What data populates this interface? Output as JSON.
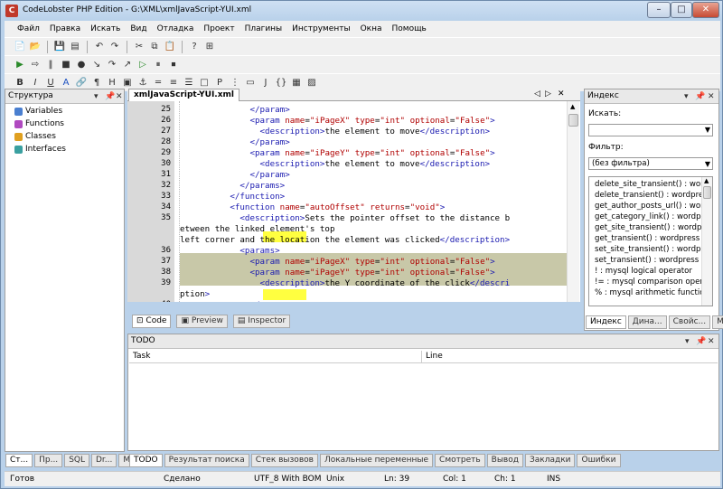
{
  "window": {
    "title": "CodeLobster PHP Edition - G:\\XML\\xmlJavaScript-YUI.xml",
    "minimize": "–",
    "maximize": "□",
    "close": "✕"
  },
  "menu": [
    "Файл",
    "Правка",
    "Искать",
    "Вид",
    "Отладка",
    "Проект",
    "Плагины",
    "Инструменты",
    "Окна",
    "Помощь"
  ],
  "structure": {
    "title": "Структура",
    "items": [
      "Variables",
      "Functions",
      "Classes",
      "Interfaces"
    ]
  },
  "editor": {
    "tab": "xmlJavaScript-YUI.xml",
    "line_numbers": [
      "25",
      "26",
      "27",
      "28",
      "29",
      "30",
      "31",
      "32",
      "33",
      "34",
      "35",
      "",
      "",
      "36",
      "37",
      "38",
      "39",
      "",
      "40"
    ],
    "lines": [
      {
        "indent": "              ",
        "html": "</param>"
      },
      {
        "indent": "              ",
        "html": "<param name=\"iPageX\" type=\"int\" optional=\"False\">"
      },
      {
        "indent": "                ",
        "html": "<description>the element to move</description>"
      },
      {
        "indent": "              ",
        "html": "</param>"
      },
      {
        "indent": "              ",
        "html": "<param name=\"iPageY\" type=\"int\" optional=\"False\">"
      },
      {
        "indent": "                ",
        "html": "<description>the element to move</description>"
      },
      {
        "indent": "              ",
        "html": "</param>"
      },
      {
        "indent": "            ",
        "html": "</params>"
      },
      {
        "indent": "          ",
        "html": "</function>"
      },
      {
        "indent": "          ",
        "html": "<function name=\"autoOffset\" returns=\"void\">"
      },
      {
        "indent": "            ",
        "html": "<description>Sets the pointer offset to the distance b"
      },
      {
        "indent": "",
        "html": "etween the linked element's top"
      },
      {
        "indent": "",
        "html": "left corner and the location the element was clicked</description>"
      },
      {
        "indent": "            ",
        "html": "<params>"
      },
      {
        "indent": "              ",
        "html": "<param name=\"iPageX\" type=\"int\" optional=\"False\">"
      },
      {
        "indent": "              ",
        "html": "<param name=\"iPageY\" type=\"int\" optional=\"False\">"
      },
      {
        "indent": "                ",
        "html": "<description>the Y coordinate of the click</descri"
      },
      {
        "indent": "",
        "html": "ption>"
      },
      {
        "indent": "              ",
        "html": "</param>"
      }
    ],
    "view_tabs": [
      "Code",
      "Preview",
      "Inspector"
    ]
  },
  "index": {
    "title": "Индекс",
    "search_label": "Искать:",
    "filter_label": "Фильтр:",
    "filter_value": "(без фильтра)",
    "items": [
      "delete_site_transient() : wordp",
      "delete_transient() : wordpress",
      "get_author_posts_url() : wordpr",
      "get_category_link() : wordpress",
      "get_site_transient() : wordpres",
      "get_transient() : wordpress",
      "set_site_transient() : wordpres",
      "set_transient() : wordpress",
      "! : mysql logical operator",
      "!= : mysql comparison operat",
      "% : mysql arithmetic function"
    ],
    "tabs": [
      "Индекс",
      "Дина...",
      "Свойс...",
      "Мар"
    ]
  },
  "todo": {
    "title": "TODO",
    "col_task": "Task",
    "col_line": "Line"
  },
  "left_tabs": [
    "Ст...",
    "Пр...",
    "SQL",
    "Dr...",
    "М..."
  ],
  "bottom_tabs": [
    "TODO",
    "Результат поиска",
    "Стек вызовов",
    "Локальные переменные",
    "Смотреть",
    "Вывод",
    "Закладки",
    "Ошибки"
  ],
  "status": {
    "ready": "Готов",
    "done": "Сделано",
    "encoding": "UTF_8 With BOM",
    "eol": "Unix",
    "ln": "Ln: 39",
    "col": "Col: 1",
    "ch": "Ch: 1",
    "ins": "INS"
  }
}
